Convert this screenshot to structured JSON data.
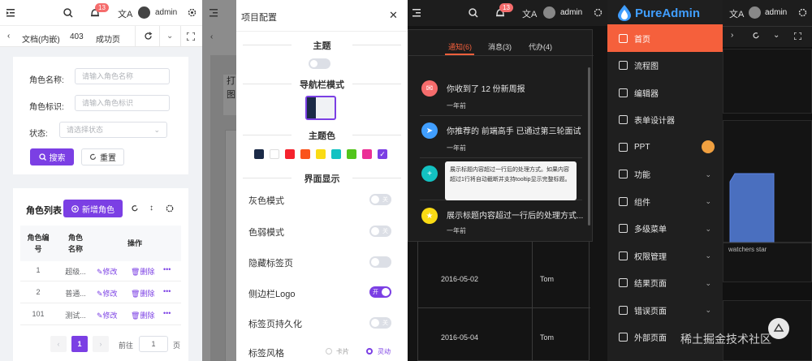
{
  "panel1": {
    "header": {
      "user": "admin",
      "badge": "13"
    },
    "tags": [
      "文档(内嵌)",
      "403",
      "成功页"
    ],
    "search": {
      "role_name_label": "角色名称:",
      "role_name_placeholder": "请输入角色名称",
      "role_code_label": "角色标识:",
      "role_code_placeholder": "请输入角色标识",
      "status_label": "状态:",
      "status_placeholder": "请选择状态",
      "search_button": "搜索",
      "reset_button": "重置"
    },
    "list": {
      "title": "角色列表",
      "add_button": "新增角色",
      "columns": {
        "id": "角色编号",
        "name": "角色名称",
        "action": "操作"
      },
      "rows": [
        {
          "id": "1",
          "name": "超级..."
        },
        {
          "id": "2",
          "name": "普通..."
        },
        {
          "id": "101",
          "name": "测试..."
        }
      ],
      "edit_label": "修改",
      "delete_label": "删除",
      "more_label": "•••"
    },
    "pagination": {
      "current": "1",
      "goto_label": "前往",
      "goto_value": "1",
      "page_suffix": "页"
    }
  },
  "panel2": {
    "drawer_title": "项目配置",
    "sections": {
      "theme": "主题",
      "nav_mode": "导航栏模式",
      "theme_color": "主题色",
      "display": "界面显示"
    },
    "options": [
      {
        "label": "灰色模式",
        "on": false,
        "text": "关"
      },
      {
        "label": "色弱模式",
        "on": false,
        "text": "关"
      },
      {
        "label": "隐藏标签页",
        "on": false,
        "text": ""
      },
      {
        "label": "侧边栏Logo",
        "on": true,
        "text": "开"
      },
      {
        "label": "标签页持久化",
        "on": false,
        "text": "关"
      }
    ],
    "tag_style": {
      "label": "标签风格",
      "opt1": "卡片",
      "opt2": "灵动"
    },
    "colors": [
      "#1b2a47",
      "#ffffff",
      "#f5222d",
      "#fa541c",
      "#fadb14",
      "#13c2c2",
      "#52c41a",
      "#eb2f96",
      "#7b3fe4"
    ],
    "underlay_text": [
      "打",
      "图"
    ]
  },
  "panel3": {
    "header": {
      "user": "admin",
      "badge": "13"
    },
    "tabs": [
      "通知(6)",
      "消息(3)",
      "代办(4)"
    ],
    "notices": [
      {
        "title": "你收到了 12 份新周报",
        "time": "一年前",
        "color": "#f56c6c"
      },
      {
        "title": "你推荐的 前端高手 已通过第三轮面试",
        "time": "一年前",
        "color": "#409eff"
      },
      {
        "title": "",
        "time": "",
        "color": "#13c2c2"
      },
      {
        "title": "展示标题内容超过一行后的处理方式...",
        "time": "一年前",
        "color": "#fadb14"
      }
    ],
    "tooltip": "展示标题内容超过一行后的处理方式。如果内容超过1行将自动截断并支持tooltip显示完整标题。",
    "table": [
      {
        "date": "2016-05-02",
        "name": "Tom"
      },
      {
        "date": "2016-05-04",
        "name": "Tom"
      }
    ]
  },
  "panel4": {
    "brand": "PureAdmin",
    "user": "admin",
    "menu": [
      {
        "label": "首页",
        "arrow": false
      },
      {
        "label": "流程图",
        "arrow": false
      },
      {
        "label": "编辑器",
        "arrow": false
      },
      {
        "label": "表单设计器",
        "arrow": false
      },
      {
        "label": "PPT",
        "arrow": false
      },
      {
        "label": "功能",
        "arrow": true
      },
      {
        "label": "组件",
        "arrow": true
      },
      {
        "label": "多级菜单",
        "arrow": true
      },
      {
        "label": "权限管理",
        "arrow": true
      },
      {
        "label": "结果页面",
        "arrow": true
      },
      {
        "label": "错误页面",
        "arrow": true
      },
      {
        "label": "外部页面",
        "arrow": true
      }
    ],
    "chart_labels": [
      "watchers",
      "star"
    ],
    "watermark": "稀土掘金技术社区"
  }
}
